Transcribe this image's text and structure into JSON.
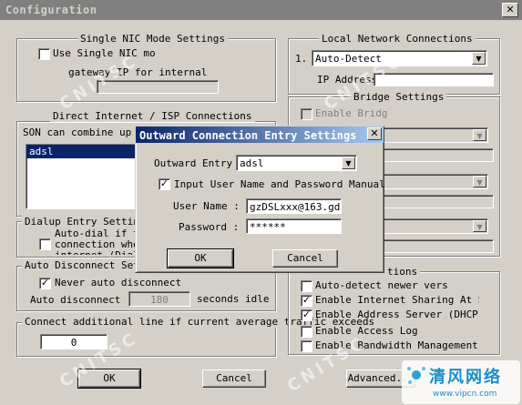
{
  "window": {
    "title": "Configuration",
    "close": "✕"
  },
  "single_nic": {
    "legend": "Single NIC Mode Settings",
    "use_single_nic": "Use Single NIC mo",
    "gateway_label": "gateway IP for internal",
    "gateway_value": ""
  },
  "local_network": {
    "legend": "Local Network  Connections",
    "row_number": "1.",
    "connection_value": "Auto-Detect",
    "ip_label": "IP Address",
    "ip_value": ""
  },
  "bridge": {
    "legend": "Bridge Settings",
    "enable_bridge": "Enable Bridg"
  },
  "direct_internet": {
    "legend": "Direct Internet / ISP  Connections",
    "description": "SON can combine up t",
    "list_items": [
      "adsl"
    ]
  },
  "dialup": {
    "legend": "Dialup Entry Setting",
    "auto_dial_line1": "Auto-dial if th",
    "auto_dial_line2": "connection when",
    "auto_dial_line3": "internet (Dial"
  },
  "auto_disconnect": {
    "legend": "Auto Disconnect Sett",
    "never_label": "Never auto disconnect",
    "never_checked": true,
    "after_label": "Auto disconnect",
    "after_value": "180",
    "unit": "seconds idle"
  },
  "additional_line": {
    "legend": "Connect additional line if current average traffic exceeds",
    "value": "0"
  },
  "options": {
    "legend": "tions",
    "items": [
      {
        "label": "Auto-detect newer vers",
        "checked": false
      },
      {
        "label": "Enable Internet Sharing At St",
        "checked": true
      },
      {
        "label": "Enable Address Server (DHCP",
        "checked": true
      },
      {
        "label": "Enable Access Log",
        "checked": false
      },
      {
        "label": "Enable Bandwidth Management",
        "checked": false
      }
    ]
  },
  "buttons": {
    "ok": "OK",
    "cancel": "Cancel",
    "advanced": "Advanced..."
  },
  "dialog": {
    "title": "Outward Connection Entry Settings",
    "close": "✕",
    "entry_label": "Outward Entry",
    "entry_value": "adsl",
    "input_credentials": "Input User Name and Password Manual",
    "input_checked": true,
    "username_label": "User Name :",
    "username_value": "gzDSLxxx@163.gd",
    "password_label": "Password :",
    "password_value": "******",
    "ok": "OK",
    "cancel": "Cancel"
  },
  "watermark": {
    "text": "CNITSC"
  },
  "logo": {
    "name": "清风网络",
    "url": "www.vipcn.com"
  },
  "icons": {
    "check": "✓",
    "dropdown": "▼",
    "close": "✕"
  }
}
